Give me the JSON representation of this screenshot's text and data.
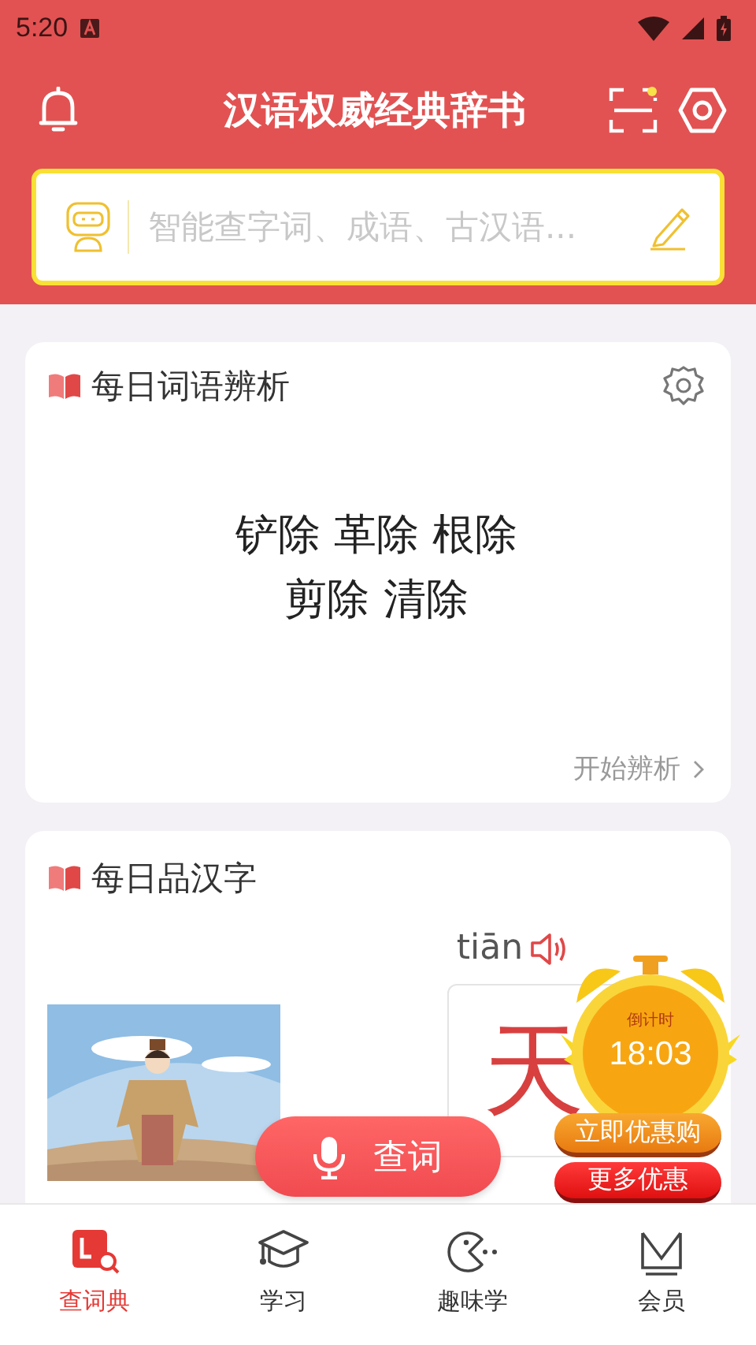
{
  "status_bar": {
    "time": "5:20"
  },
  "header": {
    "title": "汉语权威经典辞书"
  },
  "search": {
    "placeholder": "智能查字词、成语、古汉语..."
  },
  "word_card": {
    "title": "每日词语辨析",
    "lines": [
      "铲除 革除 根除",
      "剪除 清除"
    ],
    "link": "开始辨析"
  },
  "char_card": {
    "title": "每日品汉字",
    "pinyin": "tiān",
    "character": "天"
  },
  "voice_button": {
    "label": "查词"
  },
  "promo": {
    "countdown_label": "倒计时",
    "time": "18:03",
    "buy": "立即优惠购",
    "more": "更多优惠"
  },
  "nav": [
    {
      "label": "查词典",
      "kind": "dict",
      "selected": true
    },
    {
      "label": "学习",
      "kind": "cap",
      "selected": false
    },
    {
      "label": "趣味学",
      "kind": "game",
      "selected": false
    },
    {
      "label": "会员",
      "kind": "vip",
      "selected": false
    }
  ]
}
